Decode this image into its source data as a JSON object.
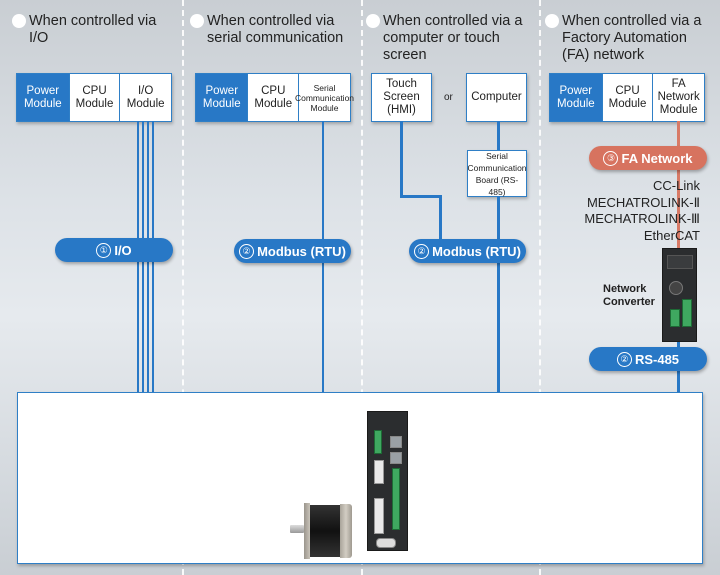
{
  "columns": [
    {
      "title": "When controlled via I/O",
      "modules": [
        "Power Module",
        "CPU Module",
        "I/O Module"
      ],
      "connection": {
        "number": "①",
        "label": "I/O"
      }
    },
    {
      "title": "When controlled via serial communication",
      "modules": [
        "Power Module",
        "CPU Module",
        "Serial Communication Module"
      ],
      "connection": {
        "number": "②",
        "label": "Modbus (RTU)"
      }
    },
    {
      "title": "When controlled via a computer or touch screen",
      "devices": [
        "Touch Screen (HMI)",
        "Computer"
      ],
      "or_label": "or",
      "intermediate": "Serial Communication Board (RS-485)",
      "connection": {
        "number": "②",
        "label": "Modbus (RTU)"
      }
    },
    {
      "title": "When controlled via a Factory Automation (FA) network",
      "modules": [
        "Power Module",
        "CPU Module",
        "FA Network Module"
      ],
      "network_connection": {
        "number": "③",
        "label": "FA Network"
      },
      "networks": [
        "CC-Link",
        "MECHATROLINK-Ⅱ",
        "MECHATROLINK-Ⅲ",
        "EtherCAT"
      ],
      "converter_label": "Network Converter",
      "connection": {
        "number": "②",
        "label": "RS-485"
      }
    }
  ],
  "colors": {
    "blue": "#2878c6",
    "orange": "#d7735f",
    "background": "#dde2e7"
  },
  "bottom_panel": {
    "items": [
      "stepping-motor",
      "driver"
    ]
  }
}
